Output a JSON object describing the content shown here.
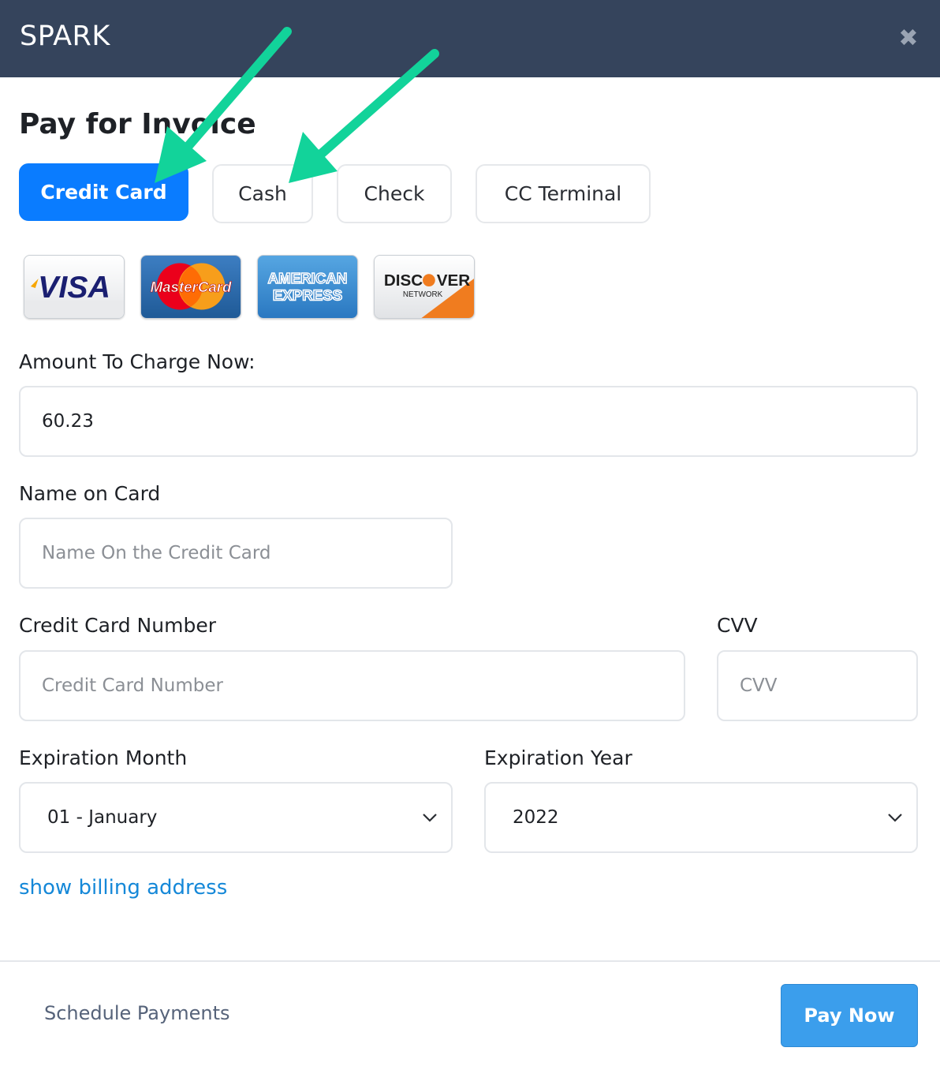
{
  "app": {
    "brand": "SPARK",
    "close_symbol": "✖"
  },
  "page": {
    "title": "Pay for Invoice"
  },
  "payment_tabs": [
    {
      "label": "Credit Card",
      "active": true
    },
    {
      "label": "Cash",
      "active": false
    },
    {
      "label": "Check",
      "active": false
    },
    {
      "label": "CC Terminal",
      "active": false
    }
  ],
  "card_logos": [
    {
      "brand": "VISA",
      "icon": "visa-logo"
    },
    {
      "brand": "MasterCard",
      "icon": "mastercard-logo"
    },
    {
      "brand": "AMERICAN EXPRESS",
      "line1": "AMERICAN",
      "line2": "EXPRESS",
      "icon": "amex-logo"
    },
    {
      "brand": "DISCOVER NETWORK",
      "line1": "DISCOVER",
      "line2": "NETWORK",
      "icon": "discover-logo"
    }
  ],
  "form": {
    "amount": {
      "label": "Amount To Charge Now:",
      "value": "60.23"
    },
    "name_on_card": {
      "label": "Name on Card",
      "placeholder": "Name On the Credit Card",
      "value": ""
    },
    "card_number": {
      "label": "Credit Card Number",
      "placeholder": "Credit Card Number",
      "value": ""
    },
    "cvv": {
      "label": "CVV",
      "placeholder": "CVV",
      "value": ""
    },
    "exp_month": {
      "label": "Expiration Month",
      "selected": "01 - January"
    },
    "exp_year": {
      "label": "Expiration Year",
      "selected": "2022"
    },
    "billing_link": "show billing address"
  },
  "footer": {
    "schedule_label": "Schedule Payments",
    "pay_label": "Pay Now"
  },
  "colors": {
    "header_bg": "#35445c",
    "active_tab": "#0a7cff",
    "pay_button": "#3b9eec",
    "link": "#1588d8",
    "annotation_arrow": "#12d39a"
  }
}
